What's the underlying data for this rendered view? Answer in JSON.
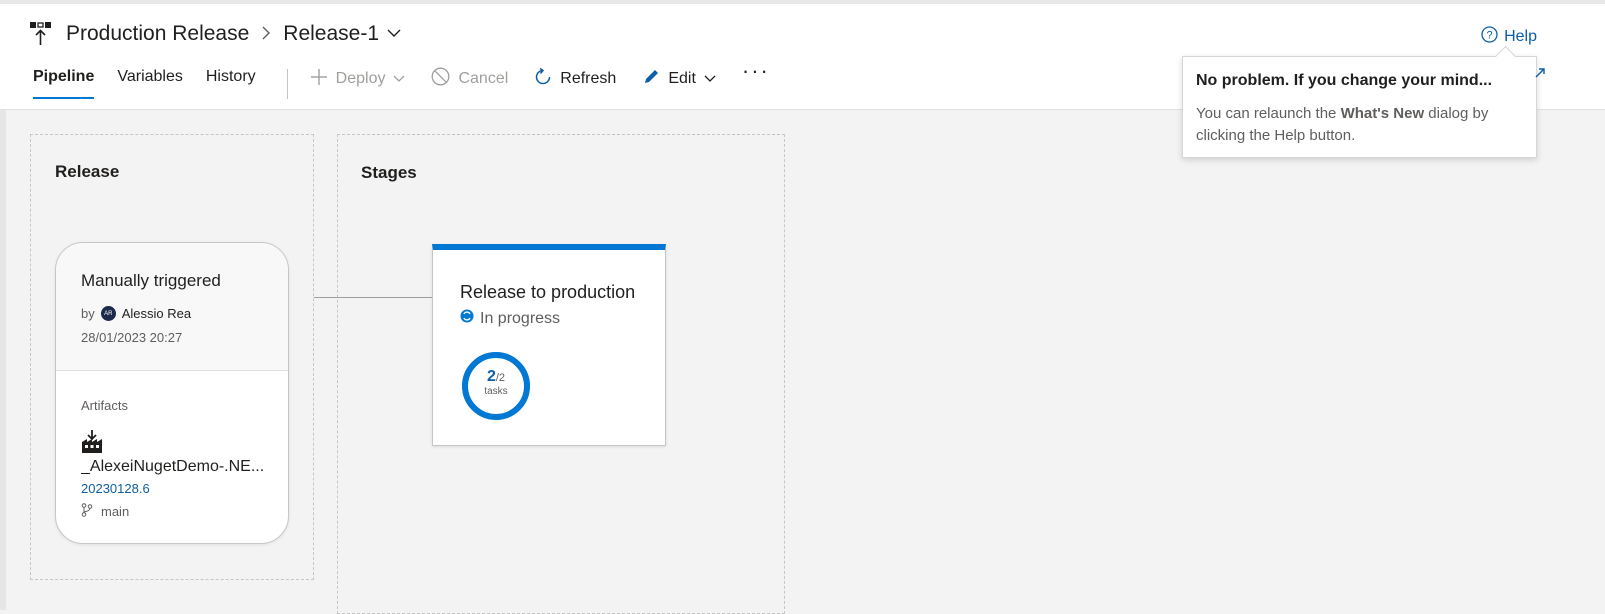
{
  "header": {
    "pipeline_name": "Production Release",
    "release_name": "Release-1",
    "help_label": "Help"
  },
  "tabs": [
    {
      "label": "Pipeline",
      "active": true
    },
    {
      "label": "Variables"
    },
    {
      "label": "History"
    }
  ],
  "toolbar": {
    "deploy_label": "Deploy",
    "cancel_label": "Cancel",
    "refresh_label": "Refresh",
    "edit_label": "Edit",
    "more_label": "···"
  },
  "release_panel": {
    "title": "Release",
    "trigger": "Manually triggered",
    "by_prefix": "by",
    "author_initials": "AR",
    "author": "Alessio Rea",
    "date": "28/01/2023 20:27",
    "artifacts_label": "Artifacts",
    "artifact_name": "_AlexeiNugetDemo-.NE...",
    "build_number": "20230128.6",
    "branch": "main"
  },
  "stages_panel": {
    "title": "Stages",
    "stage": {
      "name": "Release to production",
      "status": "In progress",
      "tasks_done": "2",
      "tasks_total": "/2",
      "tasks_label": "tasks",
      "progress": 1.0
    }
  },
  "callout": {
    "title": "No problem. If you change your mind...",
    "body_prefix": "You can relaunch the ",
    "body_bold": "What's New",
    "body_suffix": " dialog by clicking the Help button."
  },
  "colors": {
    "accent": "#0078d4",
    "link": "#0b5ea8"
  }
}
